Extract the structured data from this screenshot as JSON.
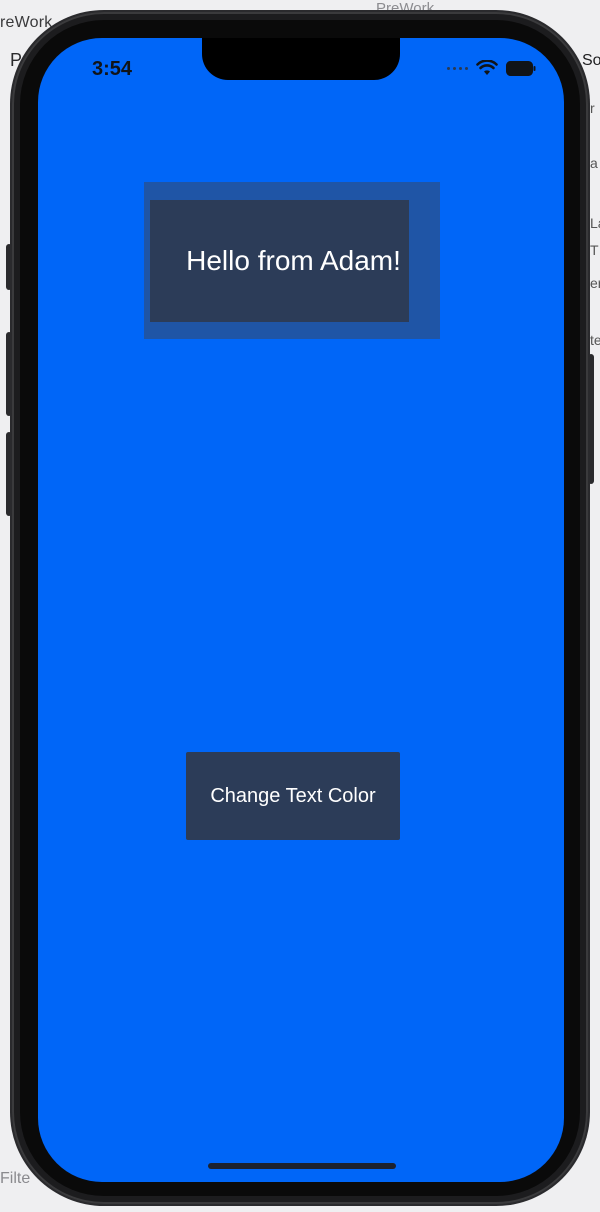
{
  "background": {
    "title_left": "reWork",
    "p_letter": "P",
    "prework_crumb": "PreWork",
    "right_so": "So",
    "right_letters": [
      "r",
      "a",
      "La",
      "T",
      "er",
      "te"
    ],
    "filter_label": "Filte"
  },
  "status_bar": {
    "time": "3:54"
  },
  "app": {
    "label_text": "Hello from Adam!",
    "button_label": "Change Text Color"
  },
  "colors": {
    "screen_background": "#0066f8",
    "label_frame": "#1f55a6",
    "control_fill": "#2c3c58",
    "text": "#ffffff"
  },
  "icons": {
    "cellular": "cellular-dots-icon",
    "wifi": "wifi-icon",
    "battery": "battery-icon"
  }
}
